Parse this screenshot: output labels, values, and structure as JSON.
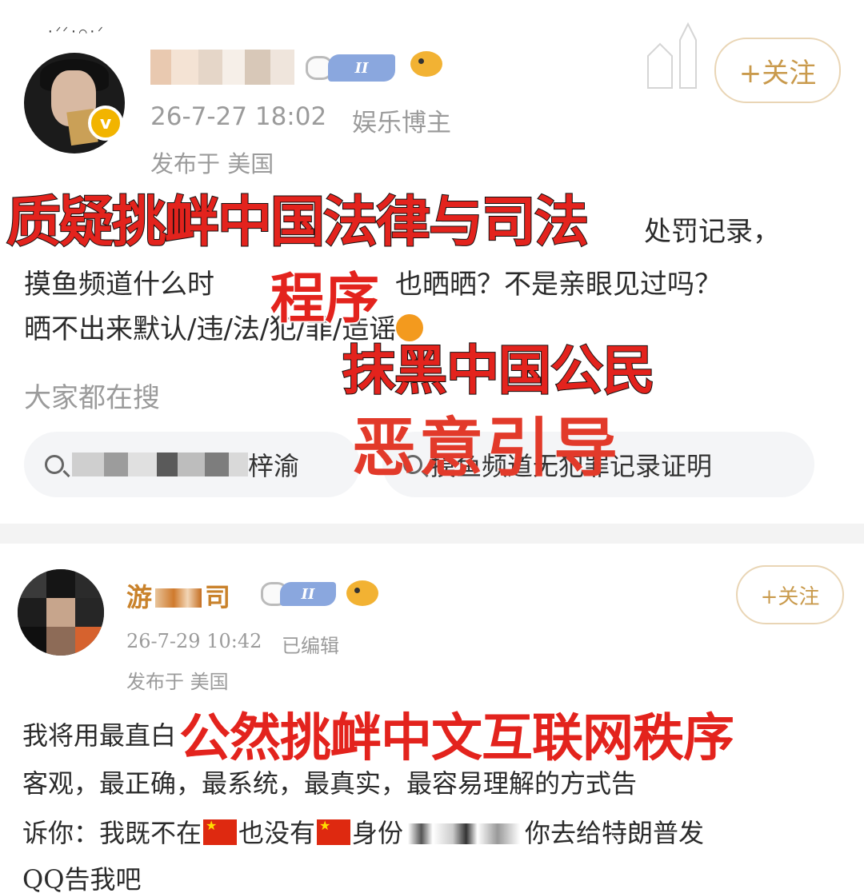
{
  "post1": {
    "username": "",
    "level_badge": "II",
    "timestamp": "26-7-27 18:02",
    "role": "娱乐博主",
    "location": "发布于 美国",
    "follow_label": "+关注",
    "body_lines": [
      "处罚记录，",
      "摸鱼频道什么时",
      "也晒晒？不是亲眼见过吗？",
      "晒不出来默认/违/法/犯/罪/造谣"
    ],
    "search_section_title": "大家都在搜",
    "search_items": [
      "梓渝",
      "摸鱼频道无犯罪记录证明"
    ]
  },
  "post2": {
    "username_start": "游",
    "username_end": "司",
    "level_badge": "II",
    "timestamp": "26-7-29 10:42",
    "edited": "已编辑",
    "location": "发布于 美国",
    "follow_label": "+关注",
    "body_lines": [
      "我将用最直白",
      "客观，最正确，最系统，最真实，最容易理解的方式告",
      "诉你：我既不在",
      "也没有",
      "身份",
      "你去给特朗普发",
      "QQ告我吧"
    ]
  },
  "overlays": {
    "line1": "质疑挑衅中国法律与司法",
    "line2": "程序",
    "line3": "抹黑中国公民",
    "line4": "恶意引导",
    "line5": "公然挑衅中文互联网秩序"
  },
  "colors": {
    "overlay_red": "#e3231d",
    "follow_gold": "#c99a4c",
    "meta_gray": "#9b9b9b",
    "vip_pill": "#8aa7de"
  },
  "icons": [
    "verified-v-icon",
    "fish-emoji-icon",
    "bunny-badge-icon",
    "search-icon",
    "china-flag-icon",
    "orange-emoji-icon"
  ]
}
